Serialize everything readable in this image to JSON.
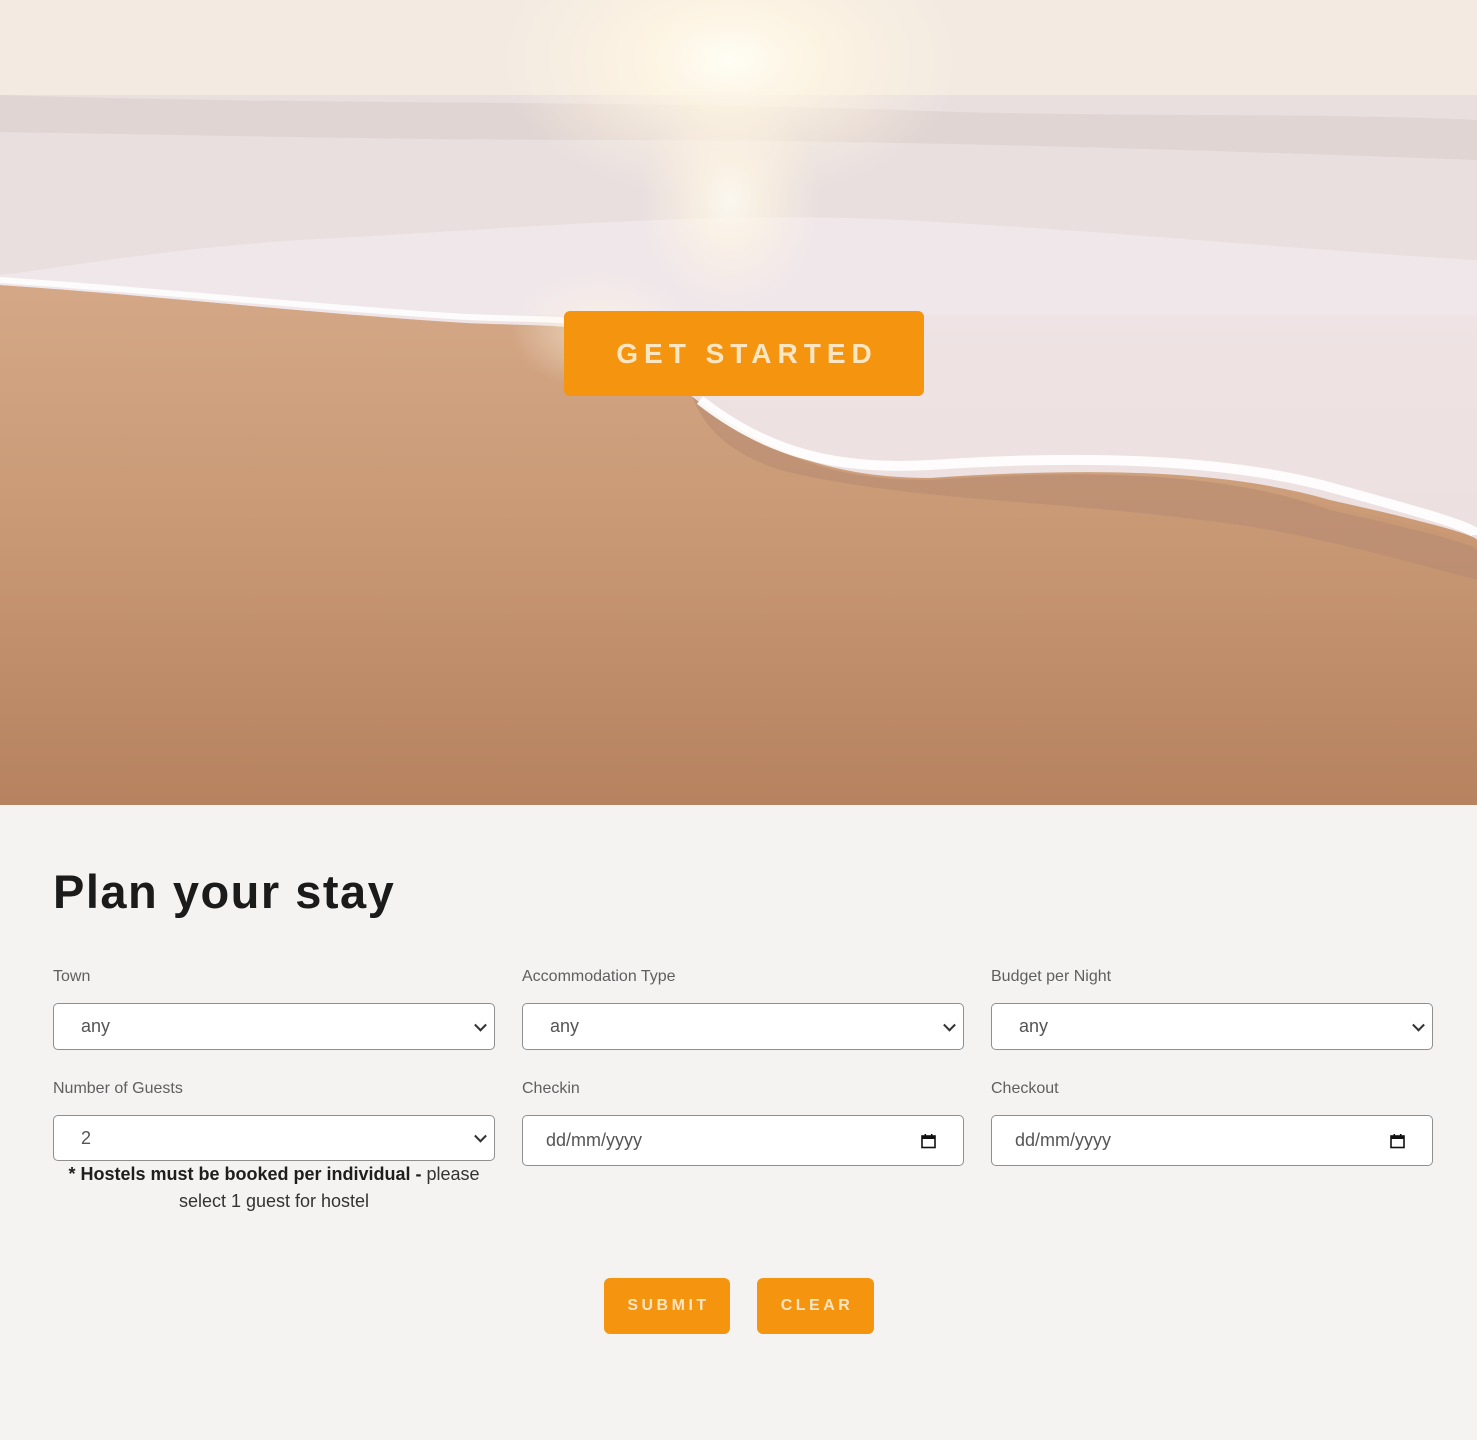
{
  "hero": {
    "cta_label": "GET STARTED"
  },
  "section": {
    "title": "Plan your stay"
  },
  "form": {
    "town": {
      "label": "Town",
      "value": "any"
    },
    "accommodation": {
      "label": "Accommodation Type",
      "value": "any"
    },
    "budget": {
      "label": "Budget per Night",
      "value": "any"
    },
    "guests": {
      "label": "Number of Guests",
      "value": "2"
    },
    "checkin": {
      "label": "Checkin",
      "placeholder": "dd/mm/yyyy"
    },
    "checkout": {
      "label": "Checkout",
      "placeholder": "dd/mm/yyyy"
    },
    "note_bold": "* Hostels must be booked per individual -",
    "note_rest": " please select 1 guest for hostel"
  },
  "actions": {
    "submit_label": "SUBMIT",
    "clear_label": "CLEAR"
  },
  "colors": {
    "accent": "#f4940f",
    "page_bg": "#f5f3f1"
  },
  "icons": {
    "select": "chevron-down-icon",
    "date": "calendar-icon"
  }
}
